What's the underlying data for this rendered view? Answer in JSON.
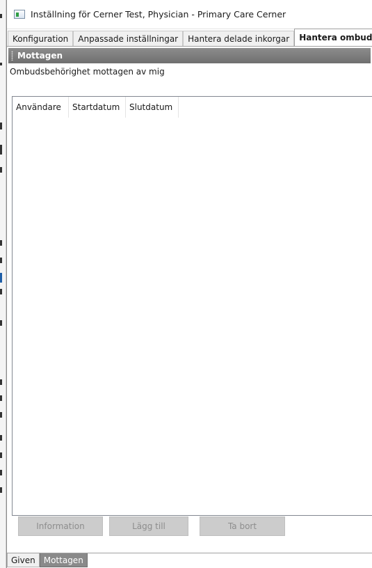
{
  "window": {
    "title": "Inställning för Cerner Test, Physician - Primary Care Cerner"
  },
  "tabs": [
    {
      "label": "Konfiguration",
      "active": false
    },
    {
      "label": "Anpassade inställningar",
      "active": false
    },
    {
      "label": "Hantera delade inkorgar",
      "active": false
    },
    {
      "label": "Hantera ombud",
      "active": true
    }
  ],
  "panel": {
    "header": "Mottagen",
    "section_label": "Ombudsbehörighet mottagen av mig"
  },
  "table": {
    "columns": [
      "Användare",
      "Startdatum",
      "Slutdatum"
    ],
    "rows": []
  },
  "buttons": {
    "information": "Information",
    "add": "Lägg till",
    "remove": "Ta bort"
  },
  "bottom_tabs": [
    {
      "label": "Given",
      "active": false
    },
    {
      "label": "Mottagen",
      "active": true
    }
  ],
  "colors": {
    "panel_header": "#7d7d7d",
    "disabled_button": "#cccccc"
  }
}
